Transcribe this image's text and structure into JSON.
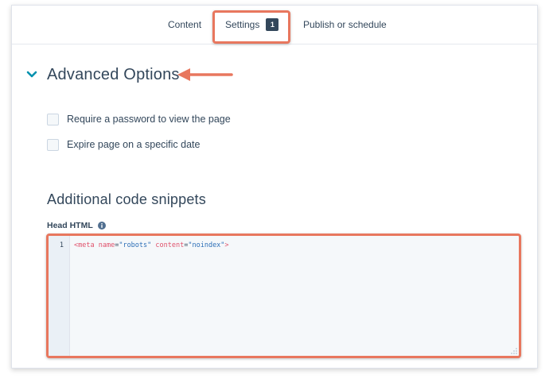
{
  "tabs": {
    "content_label": "Content",
    "settings_label": "Settings",
    "settings_badge": "1",
    "publish_label": "Publish or schedule"
  },
  "advanced": {
    "title": "Advanced Options",
    "require_password_label": "Require a password to view the page",
    "expire_page_label": "Expire page on a specific date"
  },
  "snippets": {
    "title": "Additional code snippets",
    "head_html_label": "Head HTML",
    "editor": {
      "line_number": "1",
      "tokens": {
        "open": "<meta",
        "attr1": "name",
        "eq1": "=",
        "val1": "\"robots\"",
        "attr2": "content",
        "eq2": "=",
        "val2": "\"noindex\"",
        "close": ">"
      }
    }
  },
  "colors": {
    "highlight": "#e8775e",
    "text": "#33475b",
    "chevron": "#0091ae",
    "code_tag": "#e0516b",
    "code_string": "#2d6fb7"
  },
  "icons": {
    "chevron": "chevron-down-icon",
    "info": "info-icon",
    "arrow": "arrow-left-icon",
    "resize": "resize-handle-icon"
  }
}
